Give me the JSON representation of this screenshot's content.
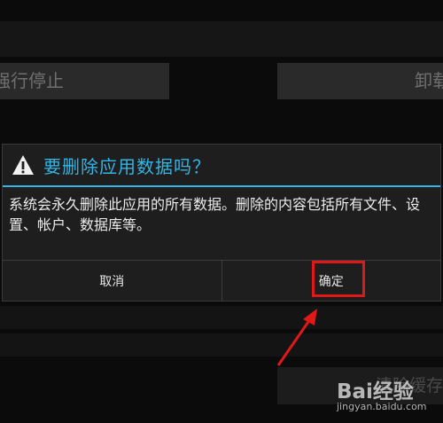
{
  "background": {
    "stop_button_label": "强行停止",
    "uninstall_button_label": "卸载",
    "clear_cache_label": "清除缓存"
  },
  "dialog": {
    "title": "要删除应用数据吗？",
    "icon": "warning-icon",
    "message": "系统会永久删除此应用的所有数据。删除的内容包括所有文件、设置、帐户、数据库等。",
    "cancel_label": "取消",
    "ok_label": "确定"
  },
  "colors": {
    "accent": "#33b5e5",
    "highlight": "#e01818"
  },
  "watermark": {
    "logo": "Bai经验",
    "url": "jingyan.baidu.com"
  }
}
